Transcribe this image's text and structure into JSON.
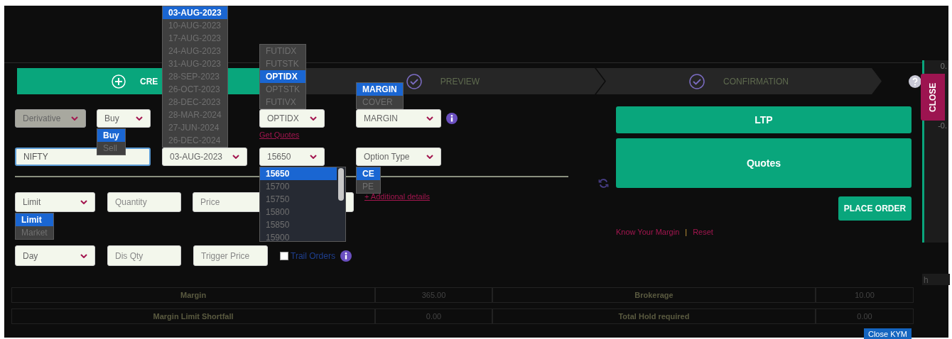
{
  "background_fragments": [
    "0.",
    "-0.",
    "h"
  ],
  "stepper": [
    {
      "label": "CRE",
      "kind": "plus",
      "selected": true
    },
    {
      "label": "PREVIEW",
      "kind": "check",
      "selected": false
    },
    {
      "label": "CONFIRMATION",
      "kind": "check",
      "selected": false
    }
  ],
  "close_tab": "CLOSE",
  "form": {
    "segment": {
      "value": "Derivative",
      "disabled": true
    },
    "side": {
      "value": "Buy",
      "disabled": false,
      "options": [
        {
          "label": "Buy",
          "selected": true
        },
        {
          "label": "Sell",
          "selected": false
        }
      ]
    },
    "expiry": {
      "value": "03-AUG-2023",
      "disabled": false,
      "options": [
        {
          "label": "03-AUG-2023",
          "selected": true
        },
        {
          "label": "10-AUG-2023",
          "selected": false
        },
        {
          "label": "17-AUG-2023",
          "selected": false
        },
        {
          "label": "24-AUG-2023",
          "selected": false
        },
        {
          "label": "31-AUG-2023",
          "selected": false
        },
        {
          "label": "28-SEP-2023",
          "selected": false
        },
        {
          "label": "26-OCT-2023",
          "selected": false
        },
        {
          "label": "28-DEC-2023",
          "selected": false
        },
        {
          "label": "28-MAR-2024",
          "selected": false
        },
        {
          "label": "27-JUN-2024",
          "selected": false
        },
        {
          "label": "26-DEC-2024",
          "selected": false
        }
      ]
    },
    "instrument": {
      "value": "OPTIDX",
      "disabled": false,
      "options": [
        {
          "label": "FUTIDX",
          "selected": false
        },
        {
          "label": "FUTSTK",
          "selected": false
        },
        {
          "label": "OPTIDX",
          "selected": true
        },
        {
          "label": "OPTSTK",
          "selected": false
        },
        {
          "label": "FUTIVX",
          "selected": false
        }
      ]
    },
    "product": {
      "value": "MARGIN",
      "disabled": false,
      "options": [
        {
          "label": "MARGIN",
          "selected": true
        },
        {
          "label": "COVER",
          "selected": false
        }
      ]
    },
    "get_quotes": "Get Quotes",
    "symbol": {
      "value": "NIFTY"
    },
    "strike": {
      "value": "15650",
      "disabled": false,
      "options": [
        {
          "label": "15650",
          "selected": true
        },
        {
          "label": "15700",
          "selected": false
        },
        {
          "label": "15750",
          "selected": false
        },
        {
          "label": "15800",
          "selected": false
        },
        {
          "label": "15850",
          "selected": false
        },
        {
          "label": "15900",
          "selected": false
        }
      ]
    },
    "option_type": {
      "value": "Option Type",
      "disabled": false,
      "options": [
        {
          "label": "CE",
          "selected": true
        },
        {
          "label": "PE",
          "selected": false
        }
      ]
    },
    "order_type": {
      "value": "Limit",
      "disabled": false,
      "options": [
        {
          "label": "Limit",
          "selected": true
        },
        {
          "label": "Market",
          "selected": false
        }
      ]
    },
    "quantity": {
      "placeholder": "Quantity"
    },
    "price": {
      "placeholder": "Price"
    },
    "additional_details": "+ Additional details",
    "validity": {
      "value": "Day",
      "disabled": false
    },
    "disclosed_qty": {
      "placeholder": "Dis Qty"
    },
    "trigger_price": {
      "placeholder": "Trigger Price"
    },
    "trail_orders": {
      "label": "Trail Orders",
      "checked": false
    }
  },
  "buttons": {
    "ltp": "LTP",
    "quotes": "Quotes",
    "place_order": "PLACE ORDER"
  },
  "links": {
    "know_your_margin": "Know Your Margin",
    "separator": "|",
    "reset": "Reset"
  },
  "summary": [
    [
      "Margin",
      "365.00",
      "Brokerage",
      "10.00"
    ],
    [
      "Margin Limit Shortfall",
      "0.00",
      "Total Hold required",
      "0.00"
    ]
  ],
  "close_kym": "Close KYM"
}
